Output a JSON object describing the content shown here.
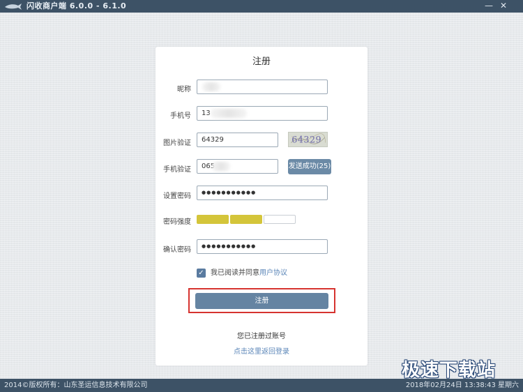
{
  "window": {
    "title": "闪收商户端  6.0.0 - 6.1.0",
    "minimize_glyph": "—",
    "close_glyph": "✕"
  },
  "form": {
    "title": "注册",
    "nickname_label": "昵称",
    "nickname_value": "",
    "phone_label": "手机号",
    "phone_value": "13",
    "captcha_label": "图片验证",
    "captcha_value": "64329",
    "captcha_image_text": "64329",
    "sms_label": "手机验证",
    "sms_value": "065",
    "send_button": "发送成功(25)",
    "password_label": "设置密码",
    "password_value": "●●●●●●●●●●●",
    "strength_label": "密码强度",
    "strength_level": 2,
    "strength_total": 3,
    "strength_color": "#d4c53a",
    "confirm_label": "确认密码",
    "confirm_value": "●●●●●●●●●●●",
    "agree_text": "我已阅读并同意",
    "agree_link": "用户协议",
    "agree_checked": true,
    "register_button": "注册",
    "registered_text": "您已注册过账号",
    "login_link": "点击这里返回登录"
  },
  "watermark": "极速下载站",
  "statusbar": {
    "copyright": "2014©版权所有：山东圣运信息技术有限公司",
    "datetime": "2018年02月24日 13:38:43 星期六"
  },
  "colors": {
    "titlebar": "#3d5266",
    "button": "#6584a2",
    "link": "#5b86b8",
    "highlight": "#d6332f"
  }
}
